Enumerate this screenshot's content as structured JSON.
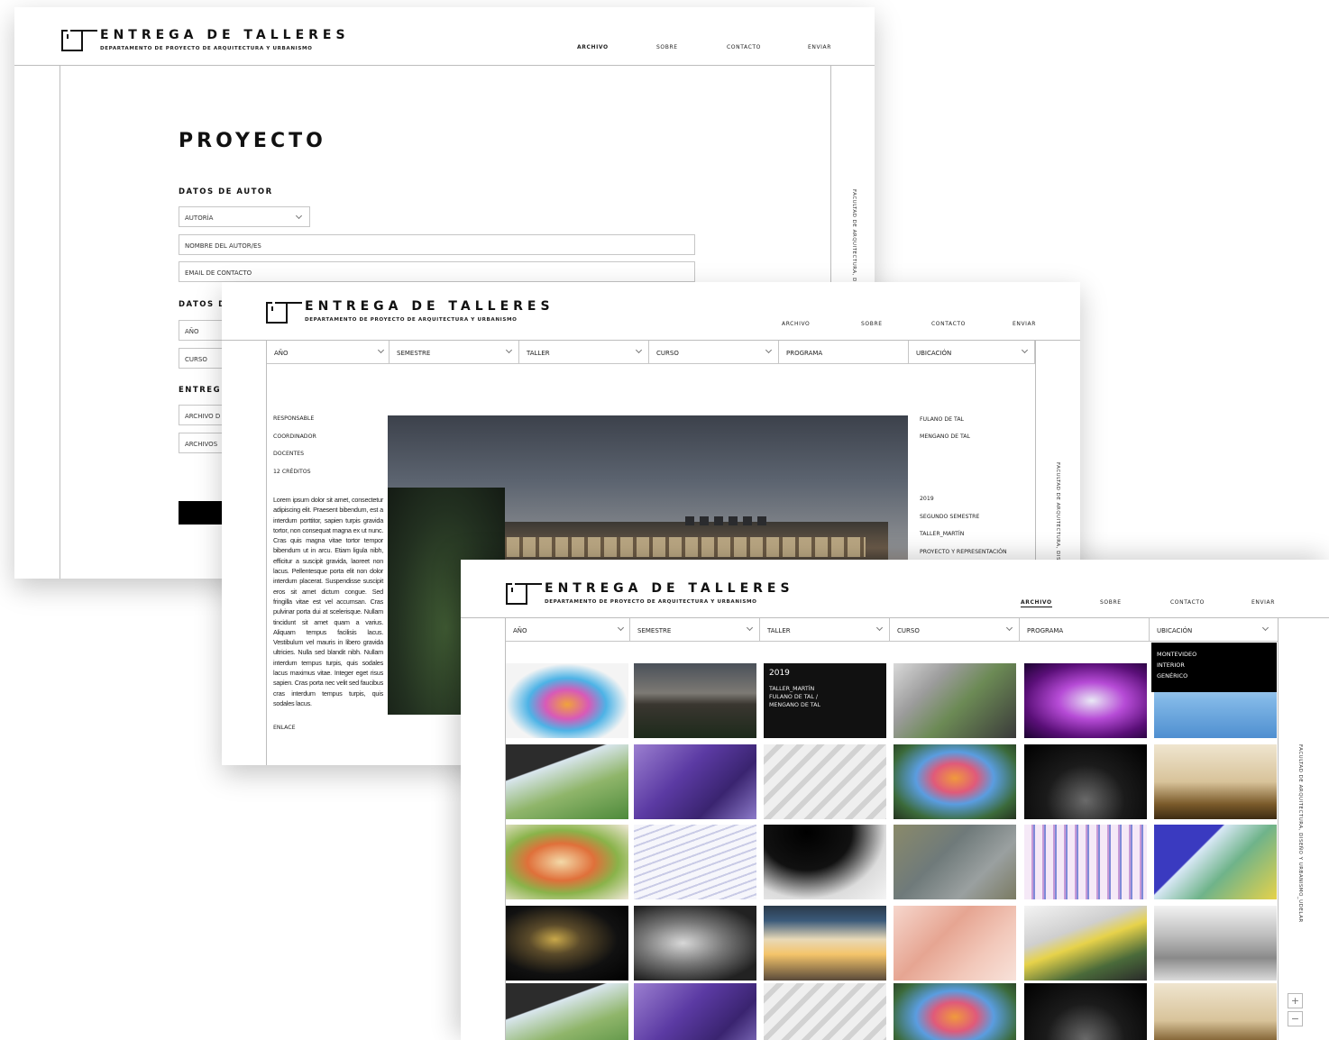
{
  "site": {
    "title": "ENTREGA DE TALLERES",
    "subtitle": "DEPARTAMENTO DE PROYECTO DE ARQUITECTURA Y URBANISMO",
    "nav": [
      "ARCHIVO",
      "SOBRE",
      "CONTACTO",
      "ENVIAR"
    ],
    "side_text": "FACULTAD DE ARQUITECTURA, DISEÑO Y URBANISMO_UDELAR",
    "side_text_short": "FACULTAD DE ARQUITECTURA, DI",
    "side_text_mid": "FACULTAD DE ARQUITECTURA, DISE"
  },
  "form": {
    "heading": "PROYECTO",
    "section_autor": "DATOS DE AUTOR",
    "autoria": "AUTORÍA",
    "nombre_placeholder": "NOMBRE DEL AUTOR/ES",
    "email_placeholder": "EMAIL DE CONTACTO",
    "section_datos": "DATOS D",
    "anio": "AÑO",
    "curso": "CURSO",
    "section_entrega": "ENTREG",
    "archivo": "ARCHIVO D",
    "archivos": "ARCHIVOS"
  },
  "filters": {
    "anio": "AÑO",
    "semestre": "SEMESTRE",
    "taller": "TALLER",
    "curso": "CURSO",
    "programa": "PROGRAMA",
    "ubicacion": "UBICACIÓN"
  },
  "project": {
    "left_meta": [
      "RESPONSABLE",
      "COORDINADOR",
      "DOCENTES",
      "12 CRÉDITOS"
    ],
    "description": "Lorem ipsum dolor sit amet, consectetur adipiscing elit. Praesent bibendum, est a interdum porttitor, sapien turpis gravida tortor, non consequat magna ex ut nunc. Cras quis magna vitae tortor tempor bibendum ut in arcu. Etiam ligula nibh, efficitur a suscipit gravida, laoreet non lacus. Pellentesque porta elit non dolor interdum placerat. Suspendisse suscipit eros sit amet dictum congue. Sed fringilla vitae est vel accumsan. Cras pulvinar porta dui at scelerisque. Nullam tincidunt sit amet quam a varius. Aliquam tempus facilisis lacus. Vestibulum vel mauris in libero gravida ultricies. Nulla sed blandit nibh. Nullam interdum tempus turpis, quis sodales lacus maximus vitae. Integer eget risus sapien. Cras porta nec velit sed faucibus cras interdum tempus turpis, quis sodales lacus.",
    "link": "ENLACE",
    "right_names": [
      "FULANO DE TAL",
      "MENGANO DE TAL"
    ],
    "right_meta": [
      "2019",
      "SEGUNDO SEMESTRE",
      "TALLER_MARTÍN",
      "PROYECTO Y REPRESENTACIÓN"
    ]
  },
  "archive": {
    "ubicacion_options": [
      "MONTEVIDEO",
      "INTERIOR",
      "GENÉRICO"
    ],
    "info_tile": {
      "year": "2019",
      "lines": [
        "TALLER_MARTÍN",
        "FULANO DE TAL /",
        "MENGANO DE TAL"
      ]
    },
    "zoom_in": "+",
    "zoom_out": "−"
  },
  "colors": {
    "ink": "#111111",
    "rule": "#bdbdbd",
    "field_border": "#c6c6c6",
    "accent_black": "#000000"
  }
}
